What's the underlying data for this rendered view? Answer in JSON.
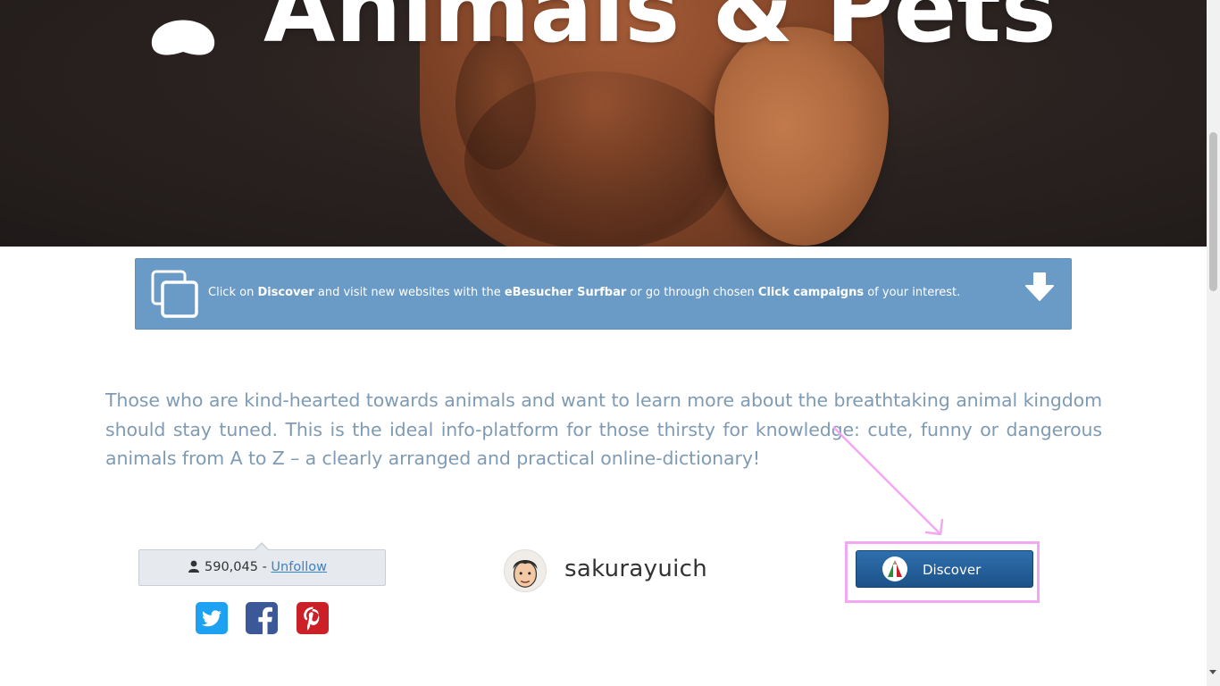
{
  "hero": {
    "title": "Animals & Pets"
  },
  "info_banner": {
    "segments": [
      {
        "text": "Click on ",
        "bold": false
      },
      {
        "text": "Discover",
        "bold": true
      },
      {
        "text": " and visit new websites with the ",
        "bold": false
      },
      {
        "text": "eBesucher Surfbar",
        "bold": true
      },
      {
        "text": " or go through chosen ",
        "bold": false
      },
      {
        "text": "Click campaigns",
        "bold": true
      },
      {
        "text": " of your interest.",
        "bold": false
      }
    ],
    "left_icon": "copy-icon",
    "right_icon": "arrow-down-icon",
    "background_color": "#6a9bc7"
  },
  "description": "Those who are kind-hearted towards animals and want to learn more about the breathtaking animal kingdom should stay tuned. This is the ideal info-platform for those thirsty for knowledge: cute, funny or dangerous animals from A to Z – a clearly arranged and practical online-dictionary!",
  "follow": {
    "count": "590,045",
    "separator": "-",
    "unfollow_label": "Unfollow",
    "user_icon": "user-icon"
  },
  "social": [
    {
      "name": "twitter",
      "icon": "twitter-icon",
      "color": "#1da1f2"
    },
    {
      "name": "facebook",
      "icon": "facebook-icon",
      "color": "#3b5998"
    },
    {
      "name": "pinterest",
      "icon": "pinterest-icon",
      "color": "#cb2027"
    }
  ],
  "profile": {
    "username": "sakurayuich",
    "avatar_icon": "avatar"
  },
  "discover": {
    "label": "Discover",
    "button_color": "#1f5a94",
    "highlight_color": "#f2a8f0"
  }
}
